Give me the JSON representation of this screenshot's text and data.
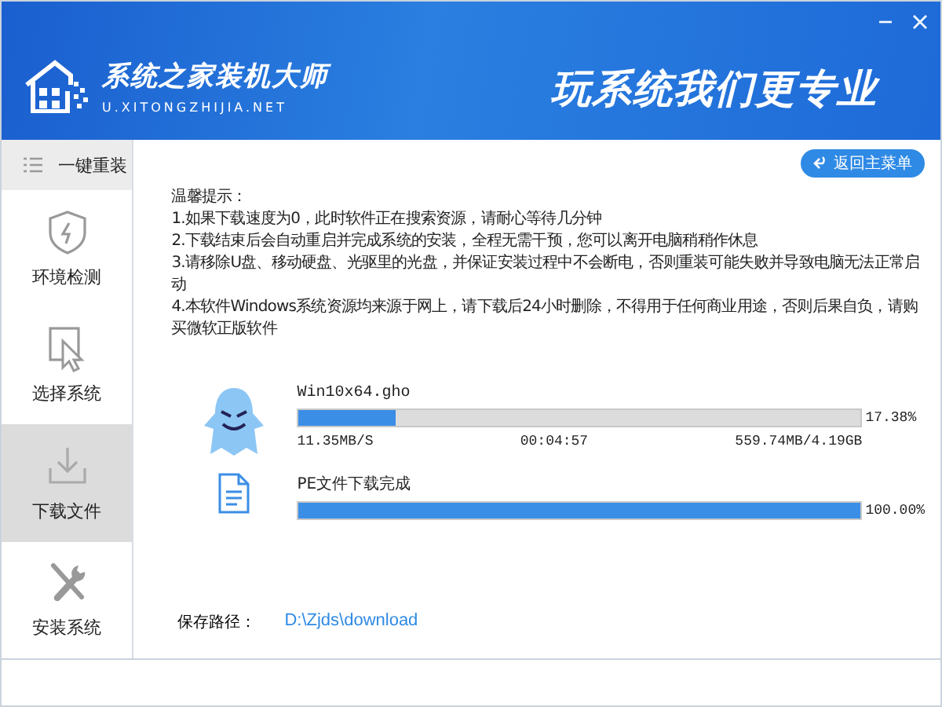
{
  "window": {
    "logo_title": "系统之家装机大师",
    "logo_subtitle": "U.XITONGZHIJIA.NET",
    "slogan": "玩系统我们更专业",
    "controls": [
      {
        "kind": "minimize"
      },
      {
        "kind": "close"
      }
    ]
  },
  "sidebar": {
    "header": "一键重装",
    "items": [
      {
        "label": "环境检测",
        "kind": "shield",
        "selected": false
      },
      {
        "label": "选择系统",
        "kind": "cursor",
        "selected": false
      },
      {
        "label": "下载文件",
        "kind": "download",
        "selected": true
      },
      {
        "label": "安装系统",
        "kind": "tools",
        "selected": false
      }
    ]
  },
  "main": {
    "back_button": "返回主菜单",
    "tips": [
      "温馨提示：",
      "1.如果下载速度为0，此时软件正在搜索资源，请耐心等待几分钟",
      "2.下载结束后会自动重启并完成系统的安装，全程无需干预，您可以离开电脑稍稍作休息",
      "3.请移除U盘、移动硬盘、光驱里的光盘，并保证安装过程中不会断电，否则重装可能失败并导致电脑无法正常启动",
      "4.本软件Windows系统资源均来源于网上，请下载后24小时删除，不得用于任何商业用途，否则后果自负，请购买微软正版软件"
    ],
    "downloads": [
      {
        "kind": "ghost",
        "name": "Win10x64.gho",
        "level": 0.1738,
        "percent": "17.38%",
        "speed": "11.35MB/S",
        "time": "00:04:57",
        "size": "559.74MB/4.19GB"
      },
      {
        "kind": "document",
        "name": "PE文件下载完成",
        "level": 1,
        "percent": "100.00%"
      }
    ],
    "save_path": {
      "label": "保存路径：",
      "value": "D:\\Zjds\\download"
    }
  }
}
